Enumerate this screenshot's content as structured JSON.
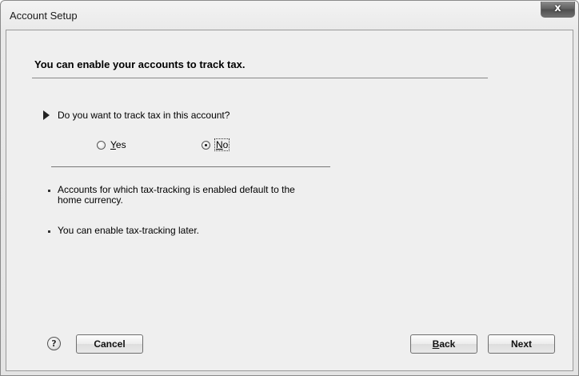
{
  "window": {
    "title": "Account Setup",
    "close_label": "x"
  },
  "content": {
    "heading": "You can enable your accounts to track tax.",
    "question": "Do you want to track tax in this account?",
    "options": [
      {
        "label": "Yes",
        "mnemonic": "Y",
        "rest": "es",
        "selected": false
      },
      {
        "label": "No",
        "mnemonic": "N",
        "rest": "o",
        "selected": true
      }
    ],
    "notes": [
      "Accounts for which tax-tracking is enabled default to the home currency.",
      "You can enable tax-tracking later."
    ]
  },
  "footer": {
    "help_symbol": "?",
    "cancel_label": "Cancel",
    "back_label": "Back",
    "back_mnemonic": "B",
    "back_rest": "ack",
    "next_label": "Next"
  }
}
